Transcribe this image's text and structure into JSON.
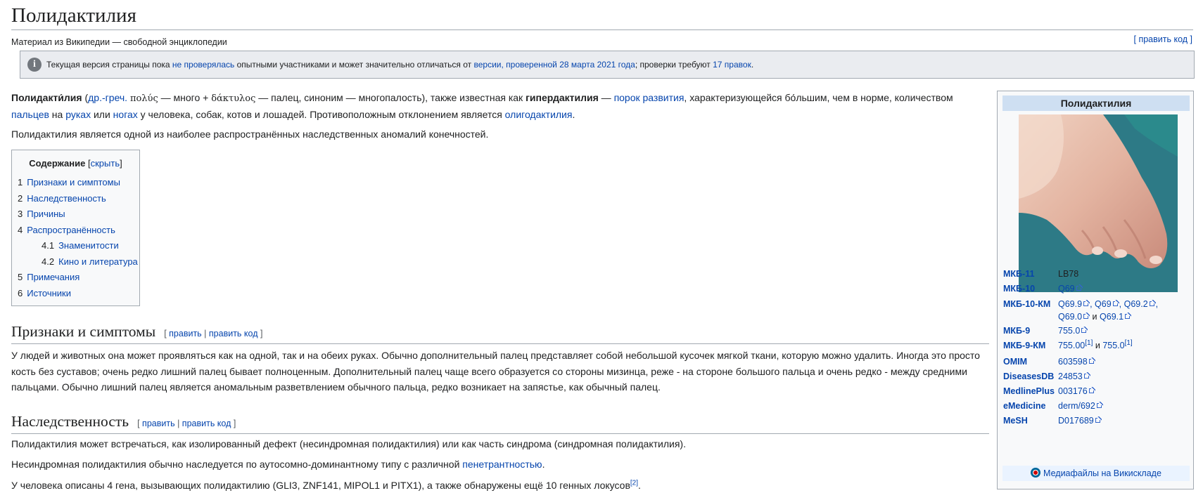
{
  "page": {
    "title": "Полидактилия",
    "tagline": "Материал из Википедии — свободной энциклопедии",
    "top_edit": "[ править код ]"
  },
  "notice": {
    "icon": "info-icon",
    "t1": "Текущая версия страницы пока ",
    "l1": "не проверялась",
    "t2": " опытными участниками и может значительно отличаться от ",
    "l2": "версии, проверенной 28 марта 2021 года",
    "t3": "; проверки требуют ",
    "l3": "17 правок",
    "t4": "."
  },
  "intro": {
    "p1": {
      "b1": "Полидакти́лия",
      "t1": " (",
      "l1": "др.-греч.",
      "t2": " ",
      "g1": "πολύς",
      "t3": " — много + ",
      "g2": "δάκτυλος",
      "t4": " — палец, синоним — многопалость), также известная как ",
      "b2": "гипердактилия",
      "t5": " — ",
      "l2": "порок развития",
      "t6": ", характеризующейся бо́льшим, чем в норме, количеством ",
      "l3": "пальцев",
      "t7": " на ",
      "l4": "руках",
      "t8": " или ",
      "l5": "ногах",
      "t9": " у человека, собак, котов и лошадей. Противоположным отклонением является ",
      "l6": "олигодактилия",
      "t10": "."
    },
    "p2": "Полидактилия является одной из наиболее распространённых наследственных аномалий конечностей."
  },
  "toc": {
    "title": "Содержание",
    "toggle": "скрыть",
    "items": [
      {
        "num": "1",
        "label": "Признаки и симптомы"
      },
      {
        "num": "2",
        "label": "Наследственность"
      },
      {
        "num": "3",
        "label": "Причины"
      },
      {
        "num": "4",
        "label": "Распространённость"
      },
      {
        "num": "4.1",
        "label": "Знаменитости"
      },
      {
        "num": "4.2",
        "label": "Кино и литература"
      },
      {
        "num": "5",
        "label": "Примечания"
      },
      {
        "num": "6",
        "label": "Источники"
      }
    ]
  },
  "sections": {
    "s1": {
      "heading": "Признаки и симптомы",
      "edit": "править",
      "edit_code": "править код",
      "text": "У людей и животных она может проявляться как на одной, так и на обеих руках. Обычно дополнительный палец представляет собой небольшой кусочек мягкой ткани, которую можно удалить. Иногда это просто кость без суставов; очень редко лишний палец бывает полноценным. Дополнительный палец чаще всего образуется со стороны мизинца, реже - на стороне большого пальца и очень редко - между средними пальцами. Обычно лишний палец является аномальным разветвлением обычного пальца, редко возникает на запястье, как обычный палец."
    },
    "s2": {
      "heading": "Наследственность",
      "edit": "править",
      "edit_code": "править код",
      "p1": "Полидактилия может встречаться, как изолированный дефект (несиндромная полидактилия) или как часть синдрома (синдромная полидактилия).",
      "p2_text": "Несиндромная полидактилия обычно наследуется по аутосомно-доминантному типу с различной ",
      "p2_link": "пенетрантностью",
      "p2_end": ".",
      "p3_text": "У человека описаны 4 гена, вызывающих полидактилию (GLI3, ZNF141, MIPOL1 и PITX1), а также обнаружены ещё 10 генных локусов",
      "p3_ref": "[2]",
      "p3_end": "."
    }
  },
  "infobox": {
    "title": "Полидактилия",
    "rows": [
      {
        "key": "МКБ-11",
        "val": "LB78"
      },
      {
        "key": "МКБ-10",
        "val": "Q69"
      },
      {
        "key": "МКБ-10-КМ",
        "v1": "Q69.9",
        "v2": "Q69",
        "v3": "Q69.2",
        "v4": "Q69.0",
        "and": "и",
        "v5": "Q69.1"
      },
      {
        "key": "МКБ-9",
        "val": "755.0"
      },
      {
        "key": "МКБ-9-КМ",
        "v1": "755.00",
        "r1": "[1]",
        "and": "и",
        "v2": "755.0",
        "r2": "[1]"
      },
      {
        "key": "OMIM",
        "val": "603598"
      },
      {
        "key": "DiseasesDB",
        "val": "24853"
      },
      {
        "key": "MedlinePlus",
        "val": "003176"
      },
      {
        "key": "eMedicine",
        "val": "derm/692"
      },
      {
        "key": "MeSH",
        "val": "D017689"
      }
    ],
    "footer": "Медиафайлы на Викискладе"
  }
}
